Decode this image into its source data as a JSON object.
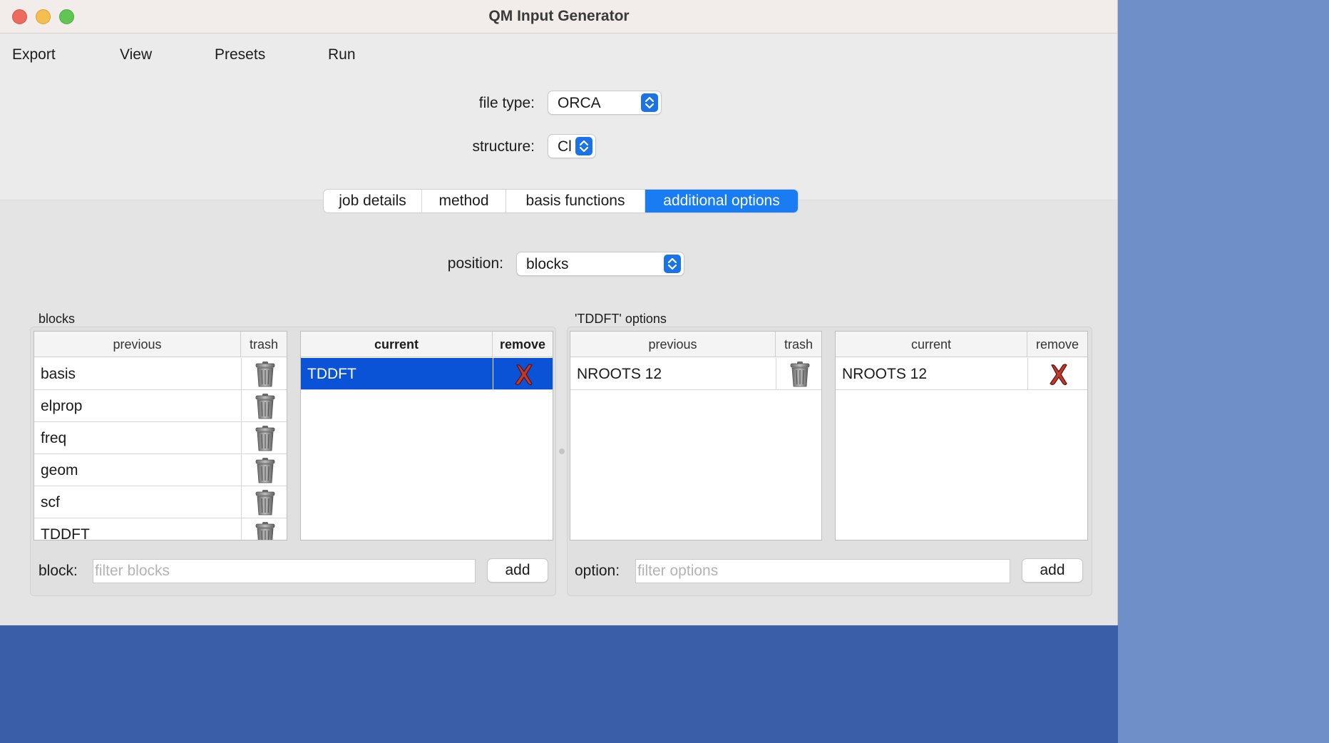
{
  "window": {
    "title": "QM Input Generator"
  },
  "menu": [
    "Export",
    "View",
    "Presets",
    "Run"
  ],
  "file_type": {
    "label": "file type:",
    "value": "ORCA"
  },
  "structure": {
    "label": "structure:",
    "value": "Cl"
  },
  "tabs": [
    "job details",
    "method",
    "basis functions",
    "additional options"
  ],
  "active_tab": "additional options",
  "position": {
    "label": "position:",
    "value": "blocks"
  },
  "blocks_panel": {
    "title": "blocks",
    "previous_table": {
      "headers": [
        "previous",
        "trash"
      ],
      "rows": [
        "basis",
        "elprop",
        "freq",
        "geom",
        "scf",
        "TDDFT"
      ]
    },
    "current_table": {
      "headers": [
        "current",
        "remove"
      ],
      "rows": [
        "TDDFT"
      ]
    },
    "filter_label": "block:",
    "filter_placeholder": "filter blocks",
    "add_label": "add"
  },
  "options_panel": {
    "title": "'TDDFT' options",
    "previous_table": {
      "headers": [
        "previous",
        "trash"
      ],
      "rows": [
        "NROOTS 12"
      ]
    },
    "current_table": {
      "headers": [
        "current",
        "remove"
      ],
      "rows": [
        "NROOTS 12"
      ]
    },
    "filter_label": "option:",
    "filter_placeholder": "filter options",
    "add_label": "add"
  },
  "colors": {
    "accent": "#1a7cf2",
    "selection": "#0b53d6",
    "remove_x": "#c0392b"
  },
  "icons": {
    "trash": "trash-icon",
    "remove": "red-x-icon",
    "stepper": "chevron-updown-icon"
  }
}
